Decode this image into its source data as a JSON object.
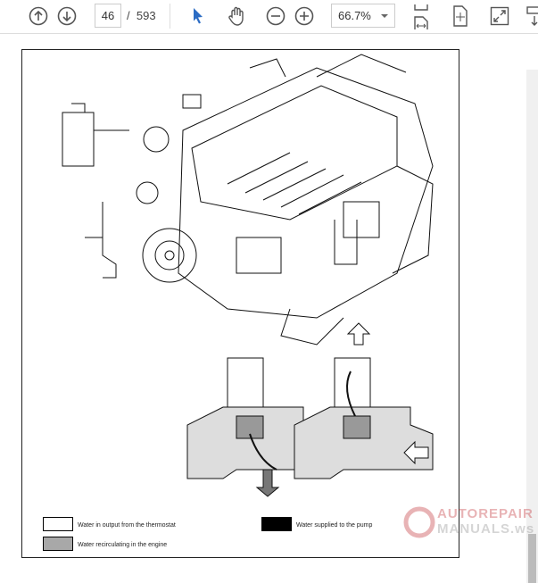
{
  "toolbar": {
    "page_current": "46",
    "page_separator": "/",
    "page_total": "593",
    "zoom": "66.7%"
  },
  "document": {
    "legend": [
      {
        "label": "Water in output from the thermostat",
        "color": "#ffffff"
      },
      {
        "label": "Water supplied to the pump",
        "color": "#000000"
      },
      {
        "label": "Water recirculating in the engine",
        "color": "#a8a8a8"
      }
    ],
    "watermark": {
      "line1": "AUTOREPAIR",
      "line2": "MANUALS.ws"
    }
  },
  "colors": {
    "accent": "#2b6cc4",
    "watermark": "#c0282d"
  }
}
